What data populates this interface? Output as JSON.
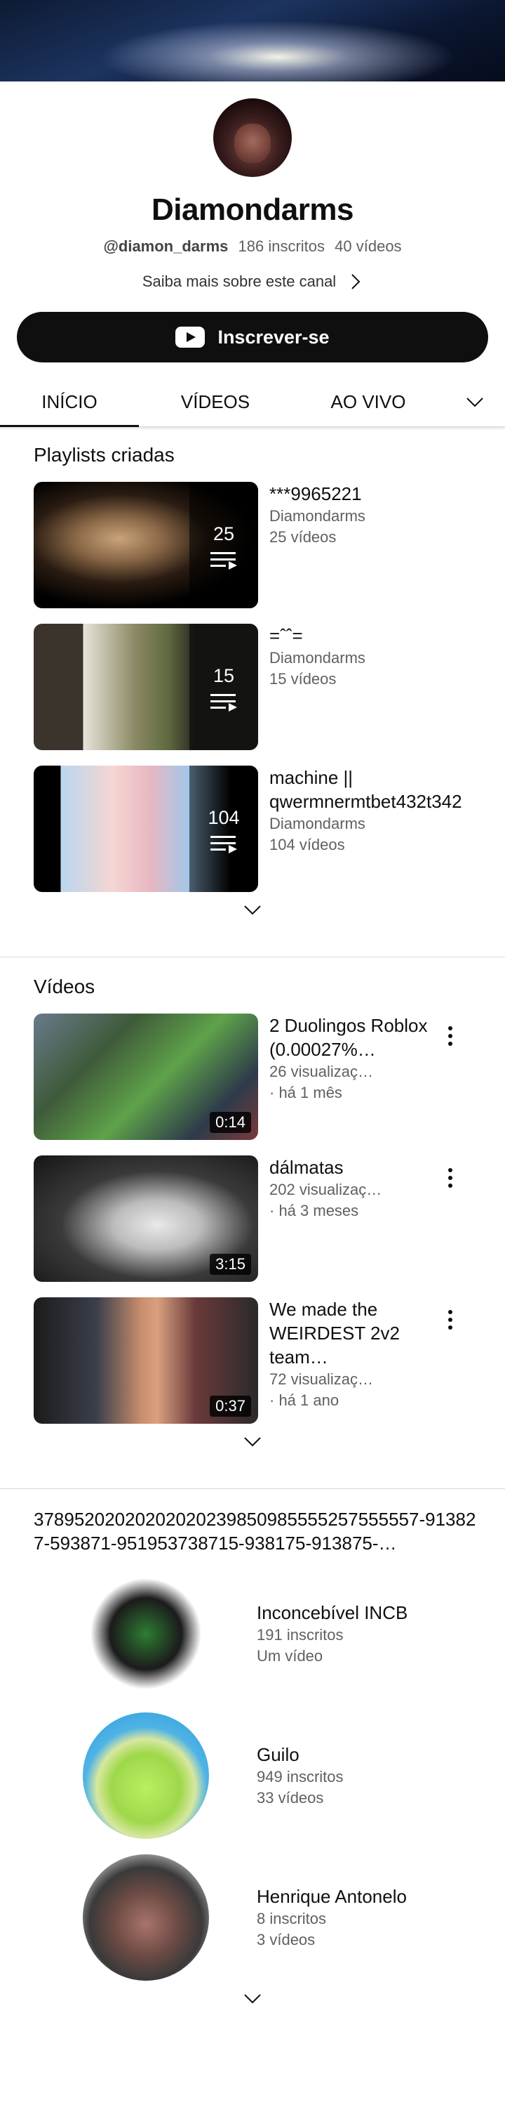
{
  "channel": {
    "name": "Diamondarms",
    "handle": "@diamon_darms",
    "subscribers": "186 inscritos",
    "videos_count": "40 vídeos",
    "about_link": "Saiba mais sobre este canal",
    "subscribe_label": "Inscrever-se"
  },
  "tabs": [
    {
      "label": "INÍCIO",
      "active": true
    },
    {
      "label": "VÍDEOS",
      "active": false
    },
    {
      "label": "AO VIVO",
      "active": false
    }
  ],
  "playlists": {
    "title": "Playlists criadas",
    "items": [
      {
        "title": "***9965221",
        "author": "Diamondarms",
        "count_text": "25 vídeos",
        "count": "25"
      },
      {
        "title": "=ˆˆ=",
        "author": "Diamondarms",
        "count_text": "15 vídeos",
        "count": "15"
      },
      {
        "title": "machine || qwermnermtbet432t342",
        "author": "Diamondarms",
        "count_text": "104 vídeos",
        "count": "104"
      }
    ]
  },
  "videos": {
    "title": "Vídeos",
    "items": [
      {
        "title": "2 Duolingos Roblox (0.00027%…",
        "views": "26 visualizaç…",
        "age": "· há 1 mês",
        "duration": "0:14"
      },
      {
        "title": "dálmatas",
        "views": "202 visualizaç…",
        "age": "· há 3 meses",
        "duration": "3:15"
      },
      {
        "title": "We made the WEIRDEST 2v2 team…",
        "views": "72 visualizaç…",
        "age": "· há 1 ano",
        "duration": "0:37"
      }
    ]
  },
  "channels": {
    "title": "37895202020202020239850985555257555557-913827-593871-951953738715-938175-913875-…",
    "items": [
      {
        "name": "Inconcebível INCB",
        "subs": "191 inscritos",
        "videos": "Um vídeo"
      },
      {
        "name": "Guilo",
        "subs": "949 inscritos",
        "videos": "33 vídeos"
      },
      {
        "name": "Henrique Antonelo",
        "subs": "8 inscritos",
        "videos": "3 vídeos"
      }
    ]
  }
}
